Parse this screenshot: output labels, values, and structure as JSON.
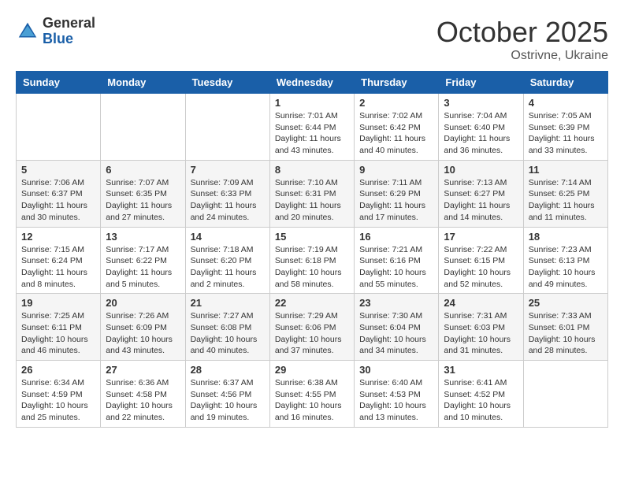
{
  "header": {
    "logo_general": "General",
    "logo_blue": "Blue",
    "month_title": "October 2025",
    "location": "Ostrivne, Ukraine"
  },
  "days_of_week": [
    "Sunday",
    "Monday",
    "Tuesday",
    "Wednesday",
    "Thursday",
    "Friday",
    "Saturday"
  ],
  "weeks": [
    [
      {
        "day": "",
        "info": ""
      },
      {
        "day": "",
        "info": ""
      },
      {
        "day": "",
        "info": ""
      },
      {
        "day": "1",
        "info": "Sunrise: 7:01 AM\nSunset: 6:44 PM\nDaylight: 11 hours\nand 43 minutes."
      },
      {
        "day": "2",
        "info": "Sunrise: 7:02 AM\nSunset: 6:42 PM\nDaylight: 11 hours\nand 40 minutes."
      },
      {
        "day": "3",
        "info": "Sunrise: 7:04 AM\nSunset: 6:40 PM\nDaylight: 11 hours\nand 36 minutes."
      },
      {
        "day": "4",
        "info": "Sunrise: 7:05 AM\nSunset: 6:39 PM\nDaylight: 11 hours\nand 33 minutes."
      }
    ],
    [
      {
        "day": "5",
        "info": "Sunrise: 7:06 AM\nSunset: 6:37 PM\nDaylight: 11 hours\nand 30 minutes."
      },
      {
        "day": "6",
        "info": "Sunrise: 7:07 AM\nSunset: 6:35 PM\nDaylight: 11 hours\nand 27 minutes."
      },
      {
        "day": "7",
        "info": "Sunrise: 7:09 AM\nSunset: 6:33 PM\nDaylight: 11 hours\nand 24 minutes."
      },
      {
        "day": "8",
        "info": "Sunrise: 7:10 AM\nSunset: 6:31 PM\nDaylight: 11 hours\nand 20 minutes."
      },
      {
        "day": "9",
        "info": "Sunrise: 7:11 AM\nSunset: 6:29 PM\nDaylight: 11 hours\nand 17 minutes."
      },
      {
        "day": "10",
        "info": "Sunrise: 7:13 AM\nSunset: 6:27 PM\nDaylight: 11 hours\nand 14 minutes."
      },
      {
        "day": "11",
        "info": "Sunrise: 7:14 AM\nSunset: 6:25 PM\nDaylight: 11 hours\nand 11 minutes."
      }
    ],
    [
      {
        "day": "12",
        "info": "Sunrise: 7:15 AM\nSunset: 6:24 PM\nDaylight: 11 hours\nand 8 minutes."
      },
      {
        "day": "13",
        "info": "Sunrise: 7:17 AM\nSunset: 6:22 PM\nDaylight: 11 hours\nand 5 minutes."
      },
      {
        "day": "14",
        "info": "Sunrise: 7:18 AM\nSunset: 6:20 PM\nDaylight: 11 hours\nand 2 minutes."
      },
      {
        "day": "15",
        "info": "Sunrise: 7:19 AM\nSunset: 6:18 PM\nDaylight: 10 hours\nand 58 minutes."
      },
      {
        "day": "16",
        "info": "Sunrise: 7:21 AM\nSunset: 6:16 PM\nDaylight: 10 hours\nand 55 minutes."
      },
      {
        "day": "17",
        "info": "Sunrise: 7:22 AM\nSunset: 6:15 PM\nDaylight: 10 hours\nand 52 minutes."
      },
      {
        "day": "18",
        "info": "Sunrise: 7:23 AM\nSunset: 6:13 PM\nDaylight: 10 hours\nand 49 minutes."
      }
    ],
    [
      {
        "day": "19",
        "info": "Sunrise: 7:25 AM\nSunset: 6:11 PM\nDaylight: 10 hours\nand 46 minutes."
      },
      {
        "day": "20",
        "info": "Sunrise: 7:26 AM\nSunset: 6:09 PM\nDaylight: 10 hours\nand 43 minutes."
      },
      {
        "day": "21",
        "info": "Sunrise: 7:27 AM\nSunset: 6:08 PM\nDaylight: 10 hours\nand 40 minutes."
      },
      {
        "day": "22",
        "info": "Sunrise: 7:29 AM\nSunset: 6:06 PM\nDaylight: 10 hours\nand 37 minutes."
      },
      {
        "day": "23",
        "info": "Sunrise: 7:30 AM\nSunset: 6:04 PM\nDaylight: 10 hours\nand 34 minutes."
      },
      {
        "day": "24",
        "info": "Sunrise: 7:31 AM\nSunset: 6:03 PM\nDaylight: 10 hours\nand 31 minutes."
      },
      {
        "day": "25",
        "info": "Sunrise: 7:33 AM\nSunset: 6:01 PM\nDaylight: 10 hours\nand 28 minutes."
      }
    ],
    [
      {
        "day": "26",
        "info": "Sunrise: 6:34 AM\nSunset: 4:59 PM\nDaylight: 10 hours\nand 25 minutes."
      },
      {
        "day": "27",
        "info": "Sunrise: 6:36 AM\nSunset: 4:58 PM\nDaylight: 10 hours\nand 22 minutes."
      },
      {
        "day": "28",
        "info": "Sunrise: 6:37 AM\nSunset: 4:56 PM\nDaylight: 10 hours\nand 19 minutes."
      },
      {
        "day": "29",
        "info": "Sunrise: 6:38 AM\nSunset: 4:55 PM\nDaylight: 10 hours\nand 16 minutes."
      },
      {
        "day": "30",
        "info": "Sunrise: 6:40 AM\nSunset: 4:53 PM\nDaylight: 10 hours\nand 13 minutes."
      },
      {
        "day": "31",
        "info": "Sunrise: 6:41 AM\nSunset: 4:52 PM\nDaylight: 10 hours\nand 10 minutes."
      },
      {
        "day": "",
        "info": ""
      }
    ]
  ]
}
